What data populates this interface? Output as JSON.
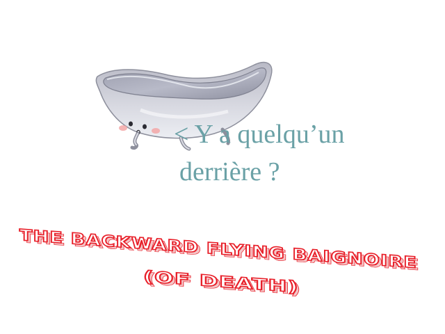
{
  "speech": {
    "line1": "< Y a quelqu’un",
    "line2": "derrière ?"
  },
  "title": {
    "line1": "THE BACKWARD FLYING BAIGNOIRE",
    "line2": "(OF DEATH)",
    "color": "#e8202a"
  },
  "character": {
    "name": "bathtub-character",
    "color": "#c9c9d2",
    "cheek_color": "#f3a7a7"
  }
}
